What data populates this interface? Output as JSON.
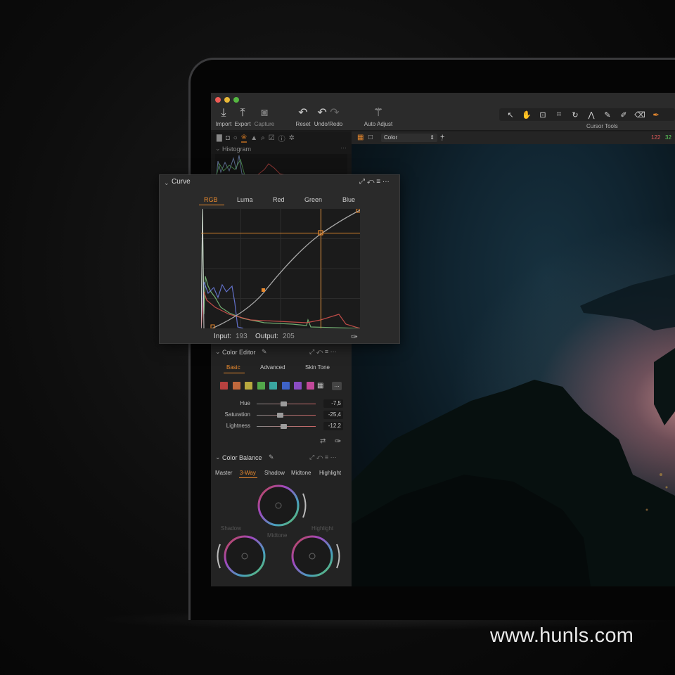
{
  "toolbar": {
    "buttons": [
      "Import",
      "Export",
      "Capture",
      "Reset",
      "Undo/Redo",
      "Auto Adjust"
    ],
    "cursor_tools_label": "Cursor Tools"
  },
  "histogram": {
    "title": "Histogram"
  },
  "viewer": {
    "color_select": "Color",
    "readout_r": "122",
    "readout_g": "32"
  },
  "curve": {
    "title": "Curve",
    "tabs": [
      "RGB",
      "Luma",
      "Red",
      "Green",
      "Blue"
    ],
    "active_tab": "RGB",
    "input_label": "Input:",
    "input_value": "193",
    "output_label": "Output:",
    "output_value": "205"
  },
  "color_editor": {
    "title": "Color Editor",
    "tabs": [
      "Basic",
      "Advanced",
      "Skin Tone"
    ],
    "swatches": [
      "#b8413f",
      "#c0683c",
      "#b8a83e",
      "#52a84a",
      "#3aa6a0",
      "#3e63c6",
      "#8a4cc2",
      "#c2489a"
    ],
    "sliders": [
      {
        "label": "Hue",
        "value": "-7,5",
        "position": 0.4
      },
      {
        "label": "Saturation",
        "value": "-25,4",
        "position": 0.35
      },
      {
        "label": "Lightness",
        "value": "-12,2",
        "position": 0.4
      }
    ]
  },
  "color_balance": {
    "title": "Color Balance",
    "tabs": [
      "Master",
      "3-Way",
      "Shadow",
      "Midtone",
      "Highlight"
    ],
    "active_tab": "3-Way",
    "wheels": [
      "Shadow",
      "Midtone",
      "Highlight"
    ]
  },
  "watermark": "www.hunls.com"
}
